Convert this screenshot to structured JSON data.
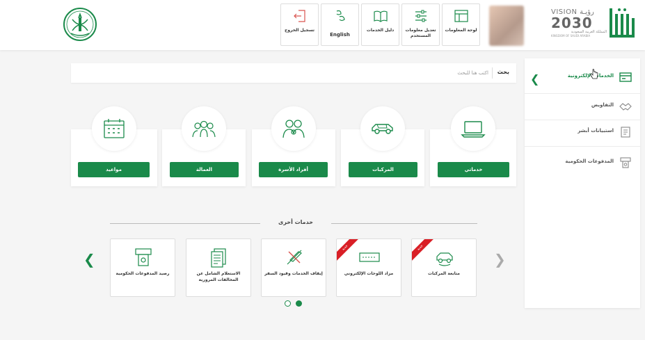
{
  "header": {
    "nav": [
      {
        "label": "لوحة المعلومات",
        "icon": "dashboard-icon"
      },
      {
        "label": "تعديل معلومات المستخدم",
        "icon": "sliders-icon"
      },
      {
        "label": "دليل الخدمات",
        "icon": "book-icon"
      },
      {
        "label": "English",
        "icon": "language-icon"
      },
      {
        "label": "تسجيل الخروج",
        "icon": "logout-icon"
      }
    ],
    "vision": {
      "title": "VISION رؤيـة",
      "year": "2030",
      "ar": "المملكة العربية السعودية",
      "en": "KINGDOM OF SAUDI ARABIA"
    }
  },
  "search": {
    "button": "بحث",
    "placeholder": "اكتب هنا للبحث"
  },
  "services": [
    {
      "label": "خدماتي",
      "icon": "laptop-icon"
    },
    {
      "label": "المركبات",
      "icon": "car-icon"
    },
    {
      "label": "أفراد الأسرة",
      "icon": "family-icon"
    },
    {
      "label": "العمالة",
      "icon": "workers-icon"
    },
    {
      "label": "مواعيد",
      "icon": "calendar-icon"
    }
  ],
  "other_services": {
    "title": "خدمات أخرى",
    "cards": [
      {
        "label": "متابعة المركبات",
        "icon": "car-follow-icon",
        "badge": "جديد"
      },
      {
        "label": "مزاد اللوحات الإلكتروني",
        "icon": "plate-icon",
        "badge": "جديد"
      },
      {
        "label": "إيقاف الخدمات وقيود السفر",
        "icon": "travel-ban-icon",
        "badge": ""
      },
      {
        "label": "الاستعلام الشامل عن المخالفات المرورية",
        "icon": "violations-icon",
        "badge": ""
      },
      {
        "label": "رصيد المدفوعات الحكومية",
        "icon": "payment-balance-icon",
        "badge": ""
      }
    ]
  },
  "sidebar": {
    "items": [
      {
        "label": "الخدمات الإلكترونية",
        "icon": "eservices-icon",
        "active": true
      },
      {
        "label": "التفاويض",
        "icon": "handshake-icon",
        "active": false
      },
      {
        "label": "استبيانات أبشر",
        "icon": "survey-icon",
        "active": false
      },
      {
        "label": "المدفوعات الحكومية",
        "icon": "government-payments-icon",
        "active": false
      }
    ]
  },
  "colors": {
    "accent": "#1a8a4a",
    "badge": "#d91f26"
  },
  "carousel": {
    "pages": 2,
    "active_page": 2
  }
}
